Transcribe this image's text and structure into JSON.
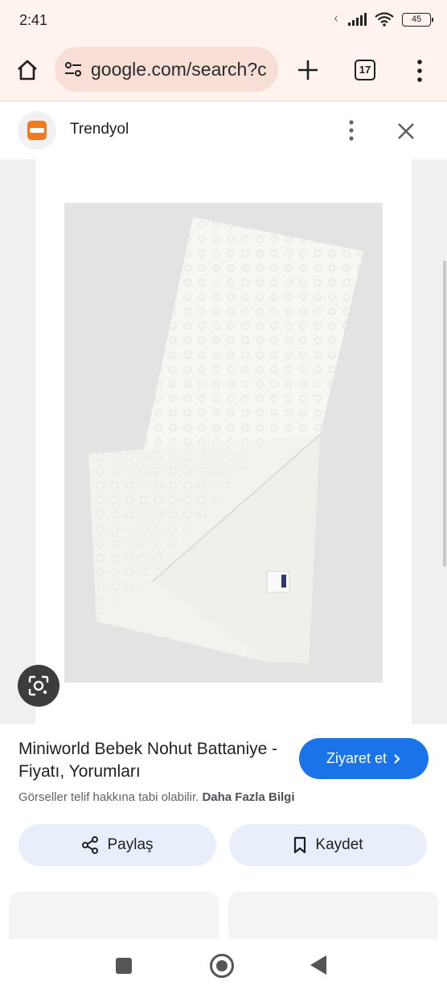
{
  "status_bar": {
    "time": "2:41",
    "battery": "45"
  },
  "browser": {
    "url": "google.com/search?c",
    "tab_count": "17"
  },
  "panel": {
    "site_name": "Trendyol"
  },
  "result": {
    "title": "Miniworld Bebek Nohut Battaniye - Fiyatı, Yorumları",
    "visit_label": "Ziyaret et",
    "copyright_notice": "Görseller telif hakkına tabi olabilir.",
    "more_info_link": "Daha Fazla Bilgi",
    "share_label": "Paylaş",
    "save_label": "Kaydet"
  },
  "colors": {
    "brand_orange": "#f27a1a",
    "visit_button": "#1a73e8",
    "chrome_toolbar": "#fff3f0",
    "action_button_bg": "#e8effb"
  },
  "icons": [
    "home-icon",
    "site-settings-icon",
    "plus-icon",
    "tabs-icon",
    "more-vert-icon",
    "close-icon",
    "lens-icon",
    "chevron-right-icon",
    "share-icon",
    "bookmark-icon"
  ]
}
